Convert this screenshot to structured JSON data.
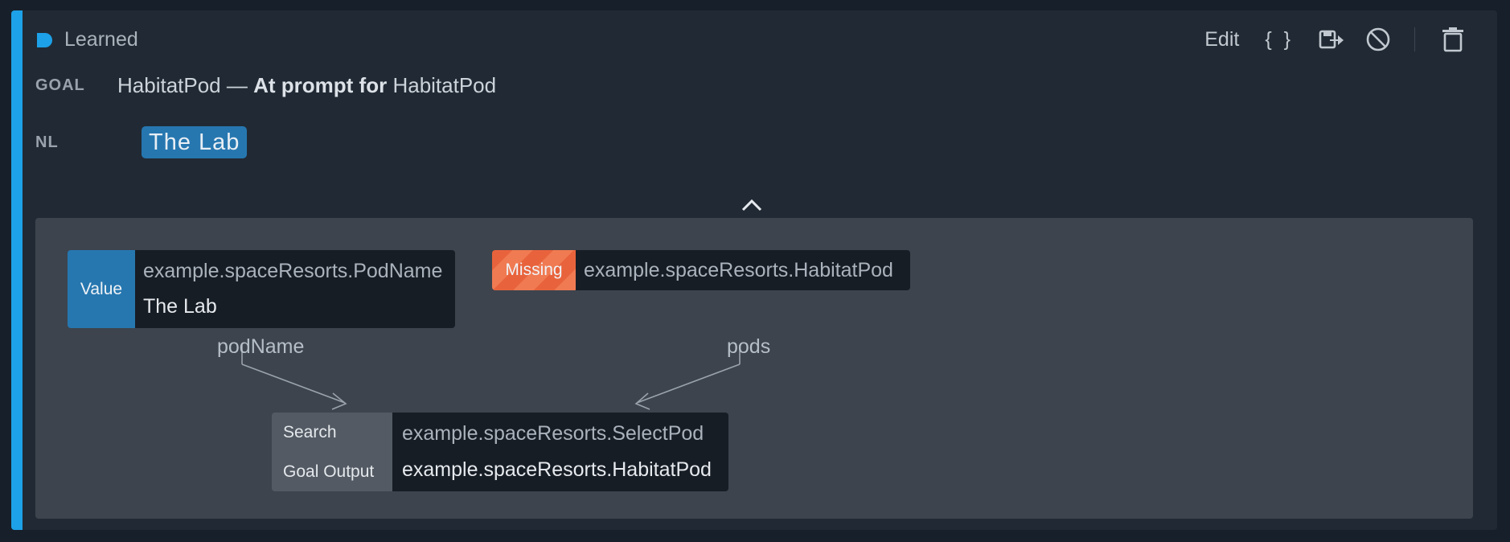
{
  "header": {
    "title": "Learned",
    "icon": "learned-badge-icon",
    "accent_color": "#1da1e8"
  },
  "toolbar": {
    "edit_label": "Edit",
    "json_label": "{ }",
    "icons": [
      "export-icon",
      "disable-icon",
      "trash-icon"
    ]
  },
  "goal": {
    "label": "GOAL",
    "type_name": "HabitatPod",
    "dash": "—",
    "prompt_label": "At prompt for",
    "prompt_target": "HabitatPod"
  },
  "nl": {
    "label": "NL",
    "chip_text": "The Lab"
  },
  "graph": {
    "value_node": {
      "tag": "Value",
      "type": "example.spaceResorts.PodName",
      "value": "The Lab"
    },
    "missing_node": {
      "tag": "Missing",
      "type": "example.spaceResorts.HabitatPod"
    },
    "edges": [
      "podName",
      "pods"
    ],
    "search_node": {
      "search_label": "Search",
      "search_value": "example.spaceResorts.SelectPod",
      "output_label": "Goal Output",
      "output_value": "example.spaceResorts.HabitatPod"
    }
  }
}
